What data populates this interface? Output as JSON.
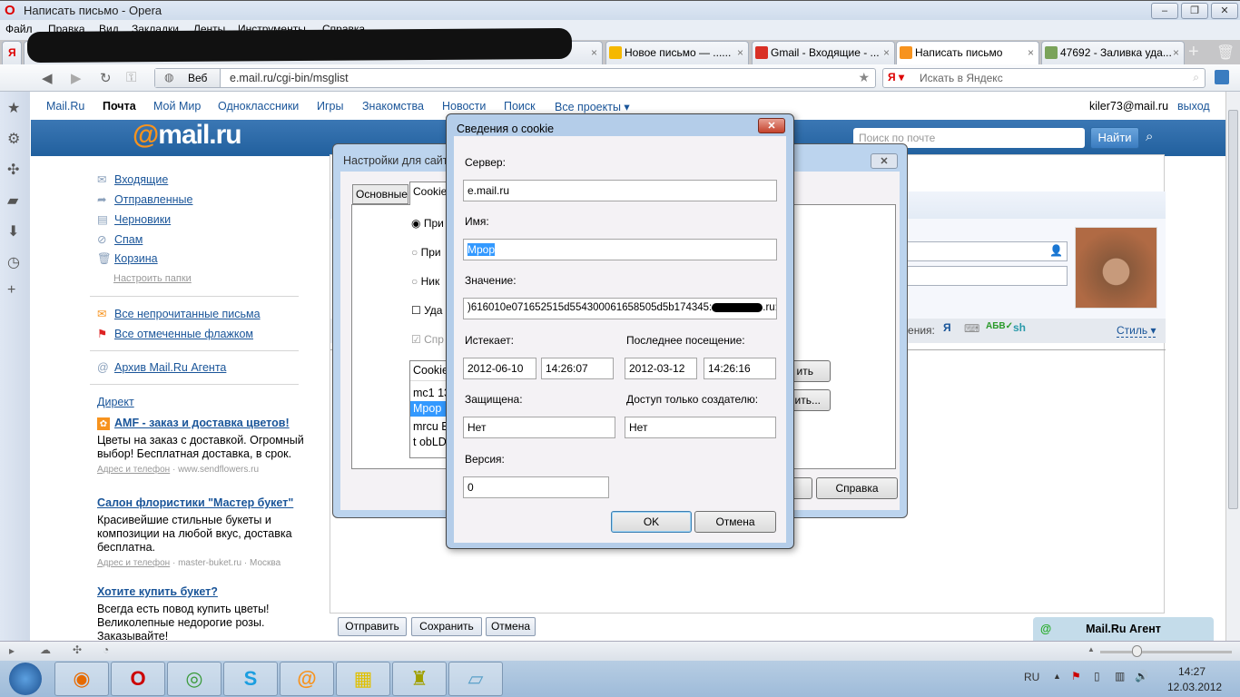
{
  "window": {
    "title": "Написать письмо - Opera",
    "minimize": "–",
    "restore": "❐",
    "close": "✕"
  },
  "menu": [
    "Файл",
    "Правка",
    "Вид",
    "Закладки",
    "Ленты",
    "Инструменты",
    "Справка"
  ],
  "tabs": [
    {
      "label": "Новое письмо — ......",
      "icon_color": "#f5b800"
    },
    {
      "label": "Gmail - Входящие - ...",
      "icon_color": "#d93025"
    },
    {
      "label": "Написать письмо",
      "icon_color": "#f7931e"
    },
    {
      "label": "47692 - Заливка уда...",
      "icon_color": "#7aa35a"
    }
  ],
  "address": {
    "veb": "Веб",
    "url": "e.mail.ru/cgi-bin/msglist",
    "search_placeholder": "Искать в Яндекс"
  },
  "topnav": {
    "items": [
      "Mail.Ru",
      "Почта",
      "Мой Мир",
      "Одноклассники",
      "Игры",
      "Знакомства",
      "Новости",
      "Поиск",
      "Все проекты ▾"
    ],
    "user": "kiler73@mail.ru",
    "logout": "выход"
  },
  "header": {
    "logo_at": "@",
    "logo_text": "mail.ru",
    "search_placeholder": "Поиск по почте",
    "find": "Найти"
  },
  "folders": [
    {
      "icon": "✉",
      "label": "Входящие"
    },
    {
      "icon": "➦",
      "label": "Отправленные"
    },
    {
      "icon": "▤",
      "label": "Черновики"
    },
    {
      "icon": "⊘",
      "label": "Спам"
    },
    {
      "icon": "🗑",
      "label": "Корзина"
    }
  ],
  "setup_folders": "Настроить папки",
  "special": [
    "Все непрочитанные письма",
    "Все отмеченные флажком"
  ],
  "archive": "Архив Mail.Ru Агента",
  "direct": "Директ",
  "ads": [
    {
      "title": "AMF - заказ и доставка цветов!",
      "text": "Цветы на заказ с доставкой. Огромный выбор! Бесплатная доставка, в срок.",
      "addr": "Адрес и телефон",
      "site": "www.sendflowers.ru",
      "city": ""
    },
    {
      "title": "Салон флористики \"Мастер букет\"",
      "text": "Красивейшие стильные букеты и композиции на любой вкус, доставка бесплатна.",
      "addr": "Адрес и телефон",
      "site": "master-buket.ru",
      "city": "Москва"
    },
    {
      "title": "Хотите купить букет?",
      "text": "Всегда есть повод купить цветы! Великолепные недорогие розы. Заказывайте!"
    }
  ],
  "compose": {
    "toolbar_tail": "жения:",
    "style": "Стиль ▾",
    "send": "Отправить",
    "save": "Сохранить",
    "cancel": "Отмена",
    "agent": "Mail.Ru Агент"
  },
  "site_dialog": {
    "title": "Настройки для сайта",
    "tabs": [
      "Основные",
      "Cookie"
    ],
    "radios": [
      "При",
      "При",
      "Ник"
    ],
    "checks": [
      "Уда",
      "Спр"
    ],
    "list_header": "Cookie",
    "list": [
      "mc1 13",
      "Mpop",
      "mrcu E",
      "t obLD"
    ],
    "btn1": "ить",
    "btn2": "ить...",
    "help": "Справка"
  },
  "cookie_dialog": {
    "title": "Сведения о cookie",
    "server_label": "Сервер:",
    "server": "e.mail.ru",
    "name_label": "Имя:",
    "name": "Mpop",
    "value_label": "Значение:",
    "value": ")616010e071652515d554300061658505d5b174345:",
    "value_tail": ".ru:",
    "expires_label": "Истекает:",
    "expires_date": "2012-06-10",
    "expires_time": "14:26:07",
    "last_label": "Последнее посещение:",
    "last_date": "2012-03-12",
    "last_time": "14:26:16",
    "secure_label": "Защищена:",
    "secure": "Нет",
    "creator_label": "Доступ только создателю:",
    "creator": "Нет",
    "version_label": "Версия:",
    "version": "0",
    "ok": "OK",
    "cancel": "Отмена"
  },
  "tray": {
    "lang": "RU",
    "time": "14:27",
    "date": "12.03.2012"
  }
}
